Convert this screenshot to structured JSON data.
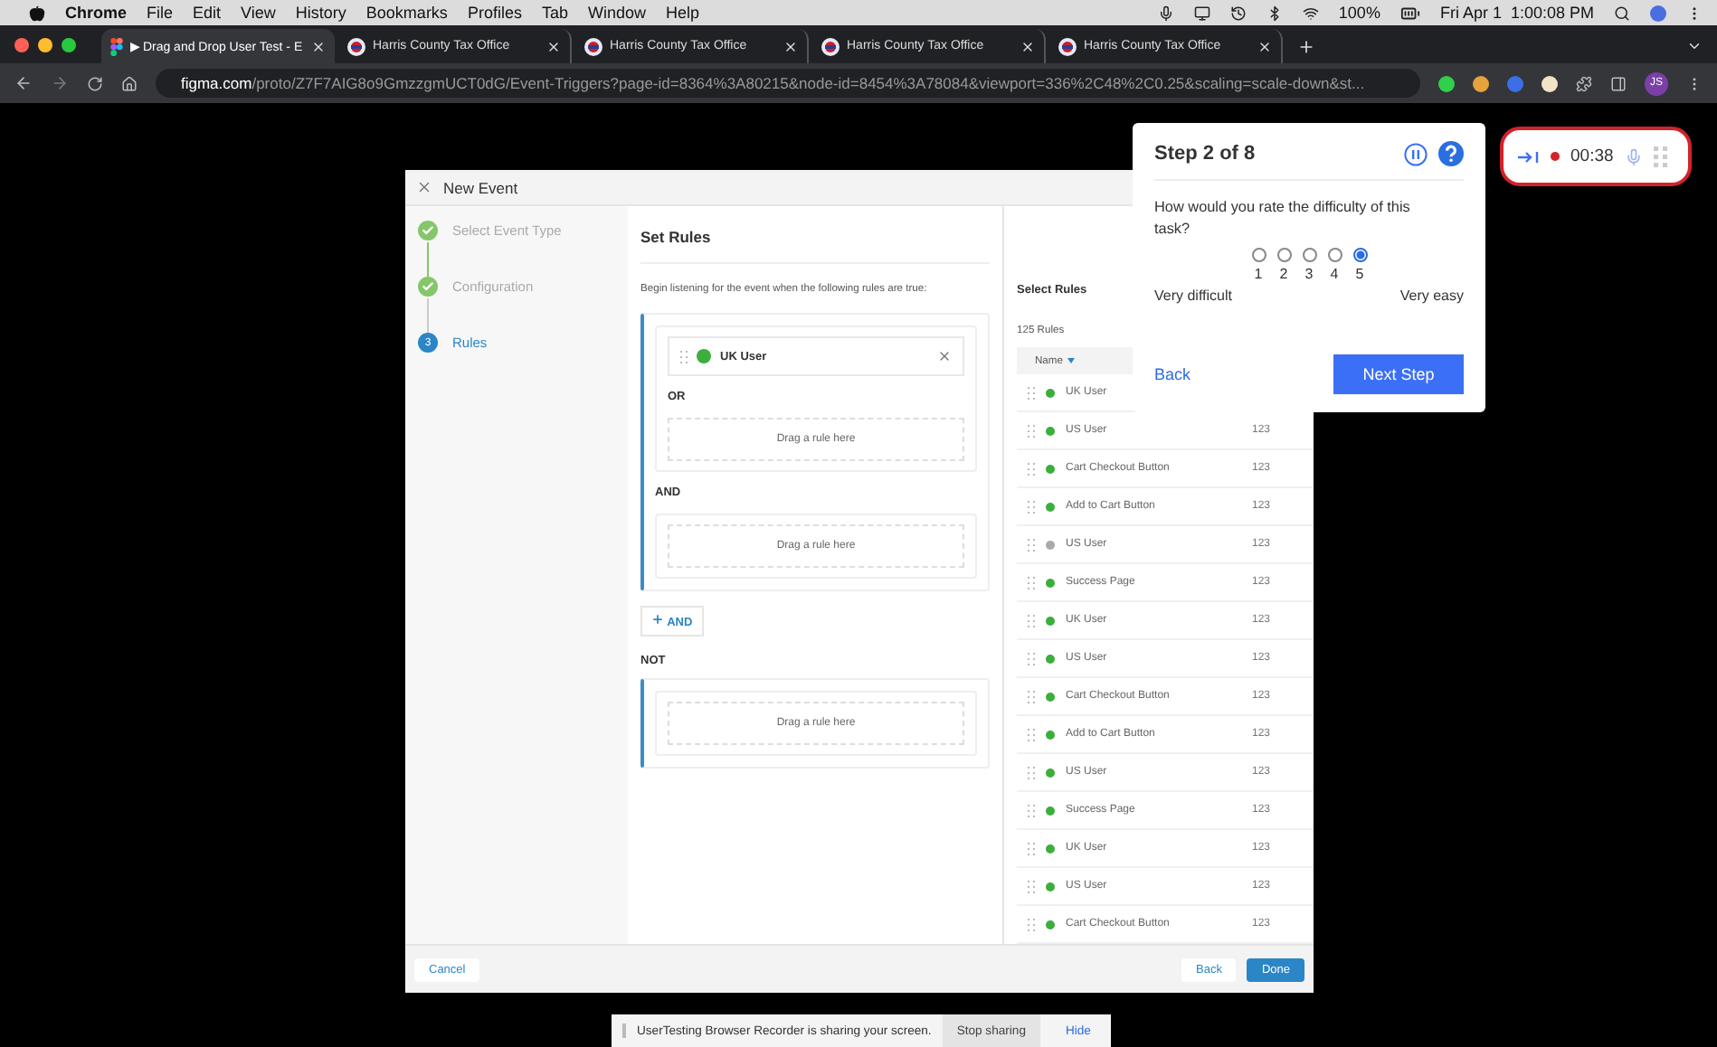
{
  "menubar": {
    "app": "Chrome",
    "menus": [
      "File",
      "Edit",
      "View",
      "History",
      "Bookmarks",
      "Profiles",
      "Tab",
      "Window",
      "Help"
    ],
    "battery": "100%",
    "clock": "Fri Apr 1  1:00:08 PM"
  },
  "tabs": [
    {
      "label": "▶ Drag and Drop User Test - E",
      "kind": "figma",
      "selected": true
    },
    {
      "label": "Harris County Tax Office",
      "kind": "site",
      "selected": false
    },
    {
      "label": "Harris County Tax Office",
      "kind": "site",
      "selected": false
    },
    {
      "label": "Harris County Tax Office",
      "kind": "site",
      "selected": false
    },
    {
      "label": "Harris County Tax Office",
      "kind": "site",
      "selected": false
    }
  ],
  "address_bar": {
    "host": "figma.com",
    "path": "/proto/Z7F7AIG8o9GmzzgmUCT0dG/Event-Triggers?page-id=8364%3A80215&node-id=8454%3A78084&viewport=336%2C48%2C0.25&scaling=scale-down&st..."
  },
  "profile": {
    "initials": "JS"
  },
  "dialog": {
    "title": "New Event",
    "steps": [
      {
        "label": "Select Event Type",
        "done": true,
        "selected": false
      },
      {
        "label": "Configuration",
        "done": true,
        "selected": false
      },
      {
        "label": "Rules",
        "done": false,
        "selected": true,
        "number": "3"
      }
    ],
    "main": {
      "title": "Set Rules",
      "instructions": "Begin listening for the event when the following rules are true:",
      "sections": [
        {
          "kind": "group",
          "children": [
            {
              "kind": "panel",
              "children": [
                {
                  "kind": "chip",
                  "name": "UK User",
                  "color": "#3cae3c"
                },
                {
                  "kind": "label",
                  "text": "OR"
                },
                {
                  "kind": "drop",
                  "text": "Drag a rule here"
                }
              ]
            },
            {
              "kind": "label",
              "text": "AND"
            },
            {
              "kind": "panel",
              "children": [
                {
                  "kind": "drop",
                  "text": "Drag a rule here"
                }
              ]
            }
          ]
        },
        {
          "kind": "add",
          "text": "AND"
        },
        {
          "kind": "heading",
          "text": "NOT"
        },
        {
          "kind": "group",
          "children": [
            {
              "kind": "panel",
              "children": [
                {
                  "kind": "drop",
                  "text": "Drag a rule here"
                }
              ]
            }
          ]
        }
      ]
    },
    "rules": {
      "title": "Select Rules",
      "count": "125 Rules",
      "column": "Name",
      "rows": [
        {
          "name": "UK User",
          "color": "#3cae3c"
        },
        {
          "name": "US User",
          "color": "#3cae3c",
          "value": "123"
        },
        {
          "name": "Cart Checkout Button",
          "color": "#3cae3c",
          "value": "123"
        },
        {
          "name": "Add to Cart Button",
          "color": "#3cae3c",
          "value": "123"
        },
        {
          "name": "US User",
          "color": "#a9a9a9",
          "value": "123"
        },
        {
          "name": "Success Page",
          "color": "#3cae3c",
          "value": "123"
        },
        {
          "name": "UK User",
          "color": "#3cae3c",
          "value": "123"
        },
        {
          "name": "US User",
          "color": "#3cae3c",
          "value": "123"
        },
        {
          "name": "Cart Checkout Button",
          "color": "#3cae3c",
          "value": "123"
        },
        {
          "name": "Add to Cart Button",
          "color": "#3cae3c",
          "value": "123"
        },
        {
          "name": "US User",
          "color": "#3cae3c",
          "value": "123"
        },
        {
          "name": "Success Page",
          "color": "#3cae3c",
          "value": "123"
        },
        {
          "name": "UK User",
          "color": "#3cae3c",
          "value": "123"
        },
        {
          "name": "US User",
          "color": "#3cae3c",
          "value": "123"
        },
        {
          "name": "Cart Checkout Button",
          "color": "#3cae3c",
          "value": "123"
        }
      ]
    },
    "footer": {
      "cancel": "Cancel",
      "back": "Back",
      "done": "Done"
    }
  },
  "survey": {
    "step": "Step 2 of 8",
    "question": "How would you rate the difficulty of this task?",
    "options": [
      {
        "label": "1",
        "selected": false
      },
      {
        "label": "2",
        "selected": false
      },
      {
        "label": "3",
        "selected": false
      },
      {
        "label": "4",
        "selected": false
      },
      {
        "label": "5",
        "selected": true
      }
    ],
    "low_label": "Very difficult",
    "high_label": "Very easy",
    "back": "Back",
    "next": "Next Step"
  },
  "recorder": {
    "time": "00:38"
  },
  "sharing": {
    "message": "UserTesting Browser Recorder is sharing your screen.",
    "stop": "Stop sharing",
    "hide": "Hide"
  }
}
